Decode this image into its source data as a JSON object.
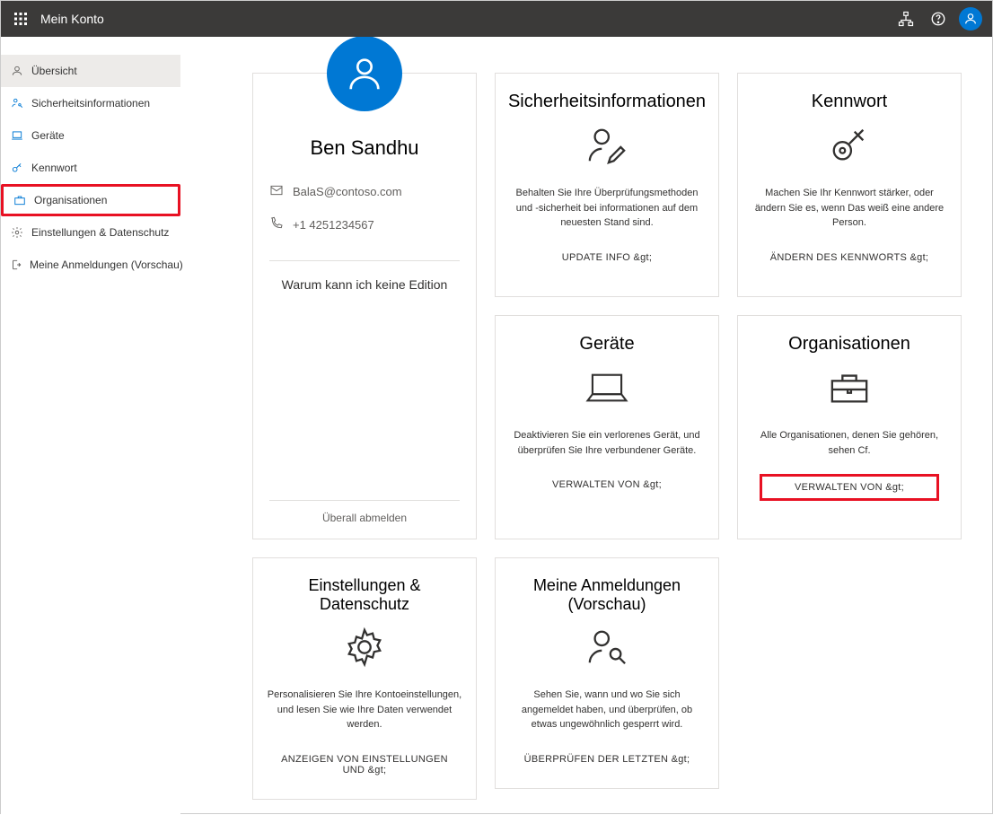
{
  "header": {
    "title": "Mein Konto"
  },
  "sidebar": {
    "items": [
      {
        "label": "Übersicht",
        "icon": "person"
      },
      {
        "label": "Sicherheitsinformationen",
        "icon": "person-key"
      },
      {
        "label": "Geräte",
        "icon": "laptop"
      },
      {
        "label": "Kennwort",
        "icon": "key"
      },
      {
        "label": "Organisationen",
        "icon": "briefcase"
      },
      {
        "label": "Einstellungen & Datenschutz",
        "icon": "gear"
      },
      {
        "label": "Meine Anmeldungen (Vorschau)",
        "icon": "signin"
      }
    ]
  },
  "profile": {
    "name": "Ben  Sandhu",
    "email": "BalaS@contoso.com",
    "phone": "+1 4251234567",
    "question": "Warum kann ich keine Edition",
    "signout": "Überall abmelden"
  },
  "cards": {
    "security": {
      "title": "Sicherheitsinformationen",
      "desc": "Behalten Sie Ihre Überprüfungsmethoden und -sicherheit bei informationen auf dem neuesten Stand sind.",
      "action": "UPDATE INFO &gt;"
    },
    "password": {
      "title": "Kennwort",
      "desc": "Machen Sie Ihr Kennwort stärker, oder ändern Sie es, wenn Das weiß eine andere Person.",
      "action": "ÄNDERN DES KENNWORTS &gt;"
    },
    "devices": {
      "title": "Geräte",
      "desc": "Deaktivieren Sie ein verlorenes Gerät, und überprüfen Sie Ihre verbundener Geräte.",
      "action": "VERWALTEN VON &gt;"
    },
    "orgs": {
      "title": "Organisationen",
      "desc": "Alle Organisationen, denen Sie gehören, sehen Cf.",
      "action": "VERWALTEN VON &gt;"
    },
    "settings": {
      "title": "Einstellungen & Datenschutz",
      "desc": "Personalisieren Sie Ihre Kontoeinstellungen, und lesen Sie wie Ihre Daten verwendet werden.",
      "action": "ANZEIGEN VON EINSTELLUNGEN UND &gt;"
    },
    "signins": {
      "title": "Meine Anmeldungen (Vorschau)",
      "desc": "Sehen Sie, wann und wo Sie sich angemeldet haben, und überprüfen, ob etwas ungewöhnlich gesperrt wird.",
      "action": "ÜBERPRÜFEN DER LETZTEN &gt;"
    }
  }
}
